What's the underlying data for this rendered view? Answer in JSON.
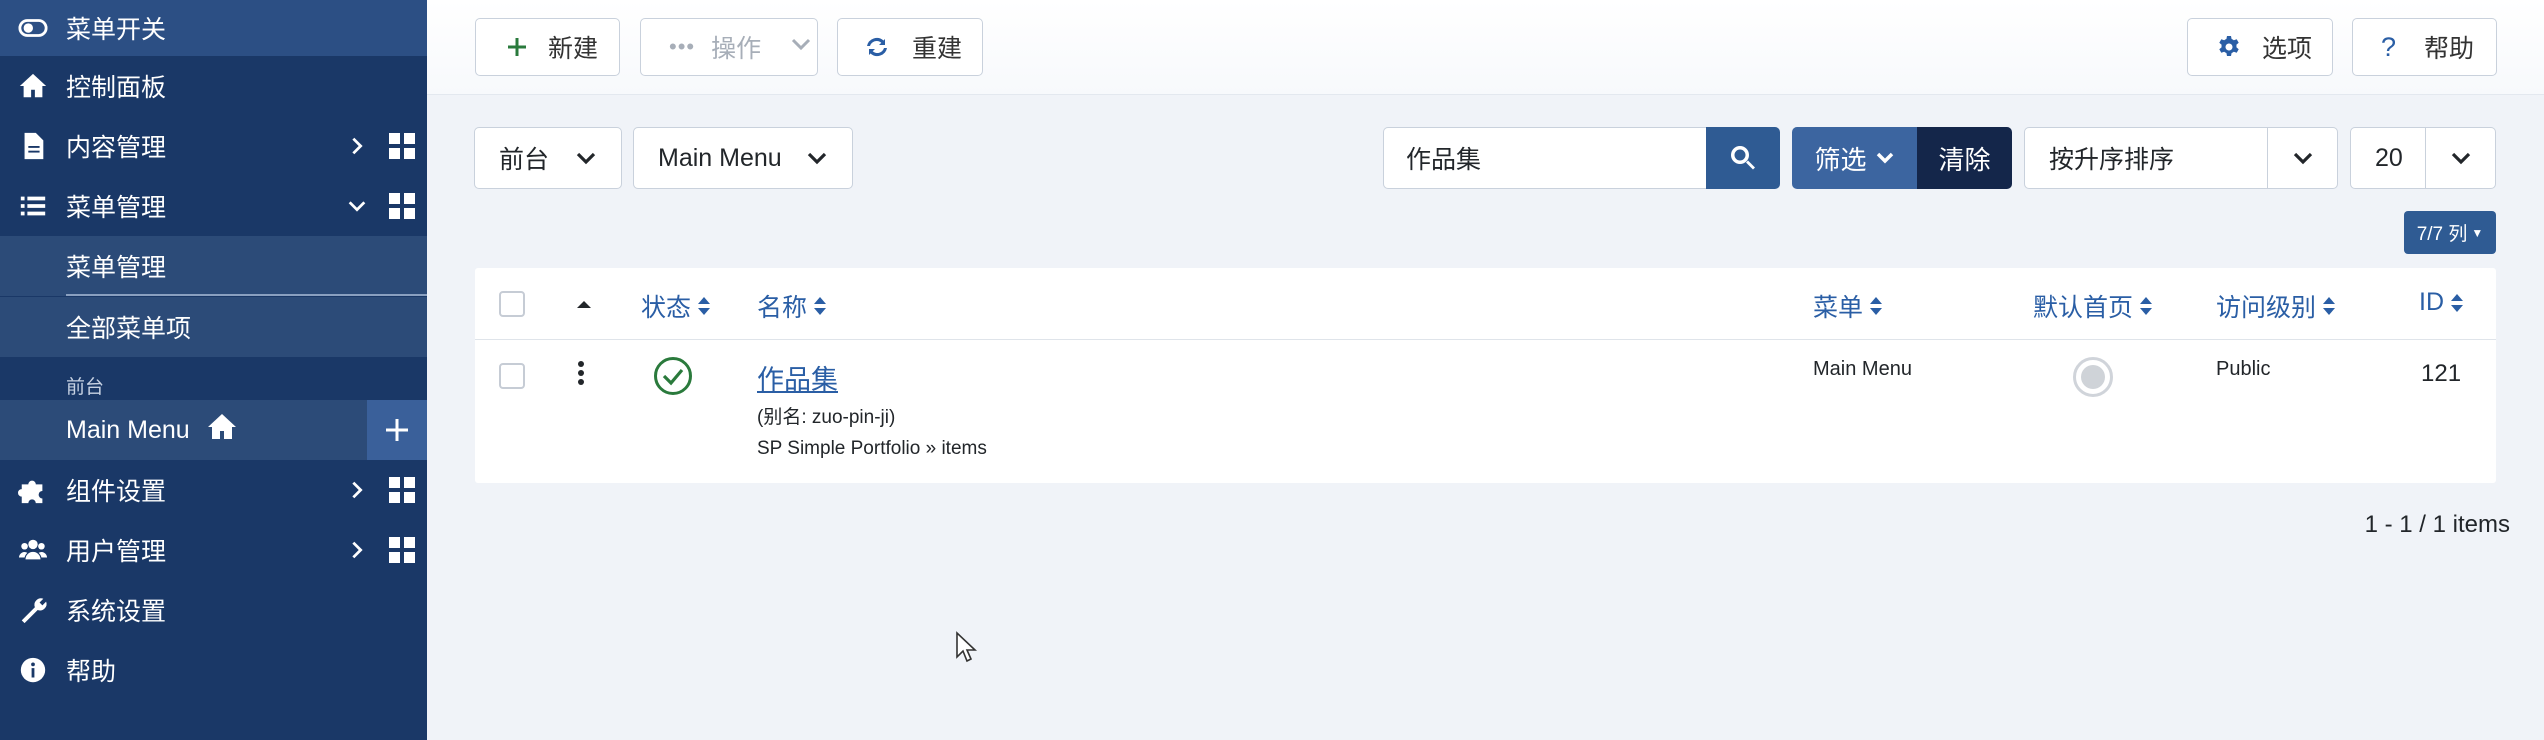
{
  "sidebar": {
    "toggle_label": "菜单开关",
    "items": [
      {
        "label": "控制面板",
        "icon": "home-icon"
      },
      {
        "label": "内容管理",
        "icon": "file-icon"
      },
      {
        "label": "菜单管理",
        "icon": "list-icon"
      },
      {
        "label": "组件设置",
        "icon": "puzzle-icon"
      },
      {
        "label": "用户管理",
        "icon": "users-icon"
      },
      {
        "label": "系统设置",
        "icon": "wrench-icon"
      },
      {
        "label": "帮助",
        "icon": "info-icon"
      }
    ],
    "menu_sub": [
      {
        "label": "菜单管理"
      },
      {
        "label": "全部菜单项"
      }
    ],
    "section_label": "前台",
    "main_menu_label": "Main Menu"
  },
  "toolbar": {
    "new_label": "新建",
    "actions_label": "操作",
    "rebuild_label": "重建",
    "options_label": "选项",
    "help_label": "帮助"
  },
  "filters": {
    "client_value": "前台",
    "menu_value": "Main Menu",
    "search_value": "作品集",
    "filter_label": "筛选",
    "clear_label": "清除",
    "sort_value": "按升序排序",
    "limit_value": "20",
    "columns_label": "7/7 列"
  },
  "table": {
    "columns": [
      "状态",
      "名称",
      "菜单",
      "默认首页",
      "访问级别",
      "ID"
    ],
    "rows": [
      {
        "title": "作品集",
        "alias_prefix": "(别名: ",
        "alias": "zuo-pin-ji",
        "alias_suffix": ")",
        "type": "SP Simple Portfolio » items",
        "menu": "Main Menu",
        "access": "Public",
        "id": "121",
        "status": "published"
      }
    ]
  },
  "pagination": {
    "info": "1 - 1 / 1 items"
  },
  "colors": {
    "sidebar_bg": "#1a3867",
    "accent": "#2a5ea5",
    "published": "#2a7a3c"
  }
}
